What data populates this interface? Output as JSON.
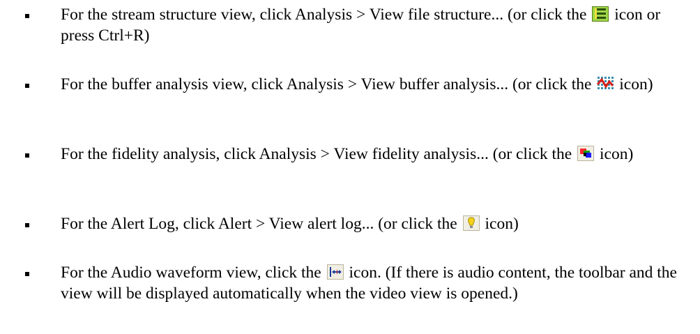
{
  "items": [
    {
      "pre": "For the stream structure view, click Analysis > View file structure... (or click the ",
      "icon": "file-structure-icon",
      "post": " icon or press Ctrl+R)"
    },
    {
      "pre": "For the buffer analysis view, click Analysis > View buffer analysis... (or click the ",
      "icon": "buffer-analysis-icon",
      "post": " icon)"
    },
    {
      "pre": "For the fidelity analysis, click Analysis > View fidelity analysis... (or click the ",
      "icon": "fidelity-analysis-icon",
      "post": " icon)"
    },
    {
      "pre": "For the Alert Log, click Alert > View alert log... (or click the ",
      "icon": "alert-log-icon",
      "post": " icon)"
    },
    {
      "pre": "For the Audio waveform view, click the ",
      "icon": "audio-waveform-icon",
      "post": " icon. (If there is audio content, the toolbar and the view will be displayed automatically when the video view is opened.)"
    }
  ]
}
